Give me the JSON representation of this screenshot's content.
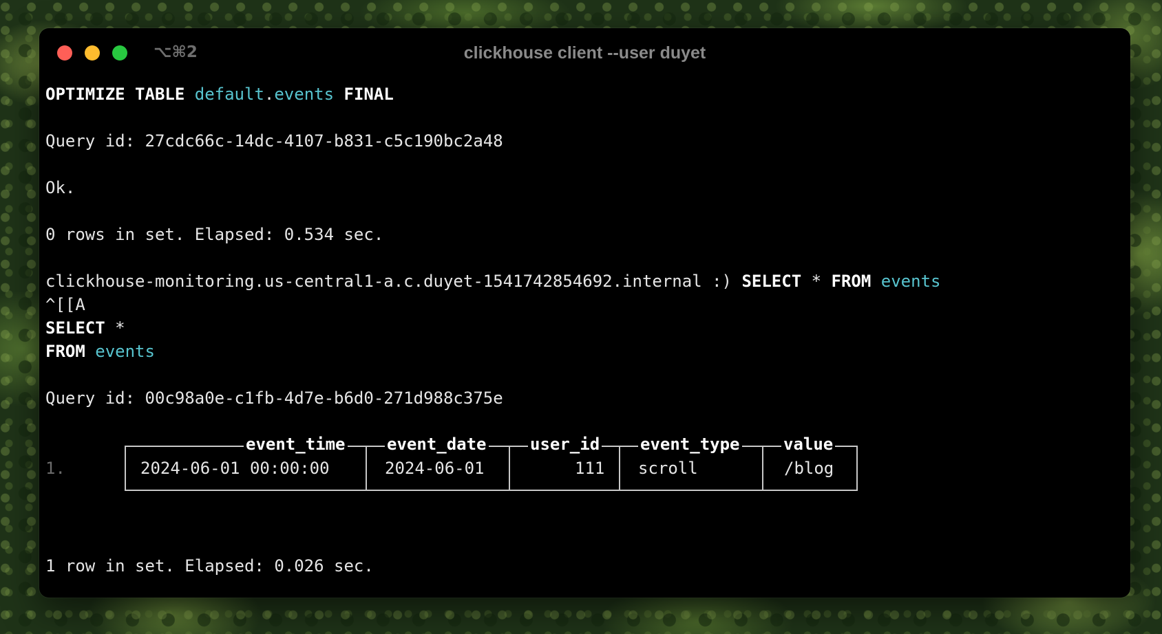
{
  "window": {
    "tab_shortcut": "⌥⌘2",
    "title": "clickhouse client --user duyet"
  },
  "terminal": {
    "optimize": {
      "kw1": "OPTIMIZE TABLE",
      "db": "default",
      "dot": ".",
      "table": "events",
      "kw2": "FINAL"
    },
    "query_id_1": "Query id: 27cdc66c-14dc-4107-b831-c5c190bc2a48",
    "ok": "Ok.",
    "result_1": "0 rows in set. Elapsed: 0.534 sec.",
    "prompt_host": "clickhouse-monitoring.us-central1-a.c.duyet-1541742854692.internal :)",
    "select_input": {
      "kw1": "SELECT",
      "star": "*",
      "kw2": "FROM",
      "table": "events"
    },
    "escape_seq": "^[[A",
    "formatted_select": {
      "kw1": "SELECT",
      "star": "*",
      "kw2": "FROM",
      "table": "events"
    },
    "query_id_2": "Query id: 00c98a0e-c1fb-4d7e-b6d0-271d988c375e",
    "result_table": {
      "columns": [
        "event_time",
        "event_date",
        "user_id",
        "event_type",
        "value"
      ],
      "rows": [
        {
          "num": "1.",
          "cells": [
            "2024-06-01 00:00:00",
            "2024-06-01",
            "111",
            "scroll",
            "/blog"
          ]
        }
      ]
    },
    "result_2": "1 row in set. Elapsed: 0.026 sec."
  }
}
